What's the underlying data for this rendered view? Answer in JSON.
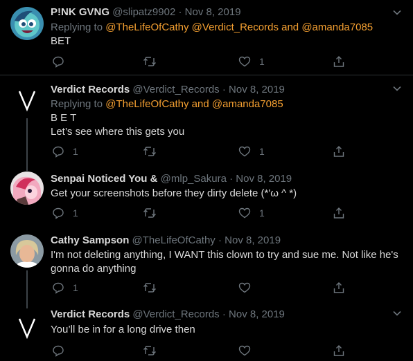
{
  "colors": {
    "background": "#000000",
    "text": "#d9d9d9",
    "muted": "#6e767d",
    "accent": "#f5a031",
    "divider": "#2f3336"
  },
  "tweets": [
    {
      "name": "P!NK GVNG",
      "handle": "@slipatz9902",
      "sep": "·",
      "date": "Nov 8, 2019",
      "replying_prefix": "Replying to",
      "mentions": [
        "@TheLifeOfCathy",
        "@Verdict_Records",
        "and",
        "@amanda7085"
      ],
      "lines": [
        "BET"
      ],
      "reply_count": "",
      "retweet_count": "",
      "like_count": "1"
    },
    {
      "name": "Verdict Records",
      "handle": "@Verdict_Records",
      "sep": "·",
      "date": "Nov 8, 2019",
      "replying_prefix": "Replying to",
      "mentions": [
        "@TheLifeOfCathy",
        "and",
        "@amanda7085"
      ],
      "lines": [
        "B E T",
        "Let’s see where this gets you"
      ],
      "reply_count": "1",
      "retweet_count": "",
      "like_count": "1"
    },
    {
      "name": "Senpai Noticed You &",
      "handle": "@mlp_Sakura",
      "sep": "·",
      "date": "Nov 8, 2019",
      "lines": [
        "Get your screenshots before they dirty delete (*'ω ^ *)"
      ],
      "reply_count": "1",
      "retweet_count": "",
      "like_count": "1"
    },
    {
      "name": "Cathy Sampson",
      "handle": "@TheLifeOfCathy",
      "sep": "·",
      "date": "Nov 8, 2019",
      "lines": [
        "I'm not deleting anything, I WANT this clown to try and sue me. Not like he's gonna do anything"
      ],
      "reply_count": "1",
      "retweet_count": "",
      "like_count": ""
    },
    {
      "name": "Verdict Records",
      "handle": "@Verdict_Records",
      "sep": "·",
      "date": "Nov 8, 2019",
      "lines": [
        "You’ll be in for a long drive then"
      ],
      "reply_count": "",
      "retweet_count": "",
      "like_count": ""
    }
  ],
  "icons": {
    "reply": "reply-icon",
    "retweet": "retweet-icon",
    "like": "heart-icon",
    "share": "share-icon",
    "more": "chevron-down-icon"
  }
}
